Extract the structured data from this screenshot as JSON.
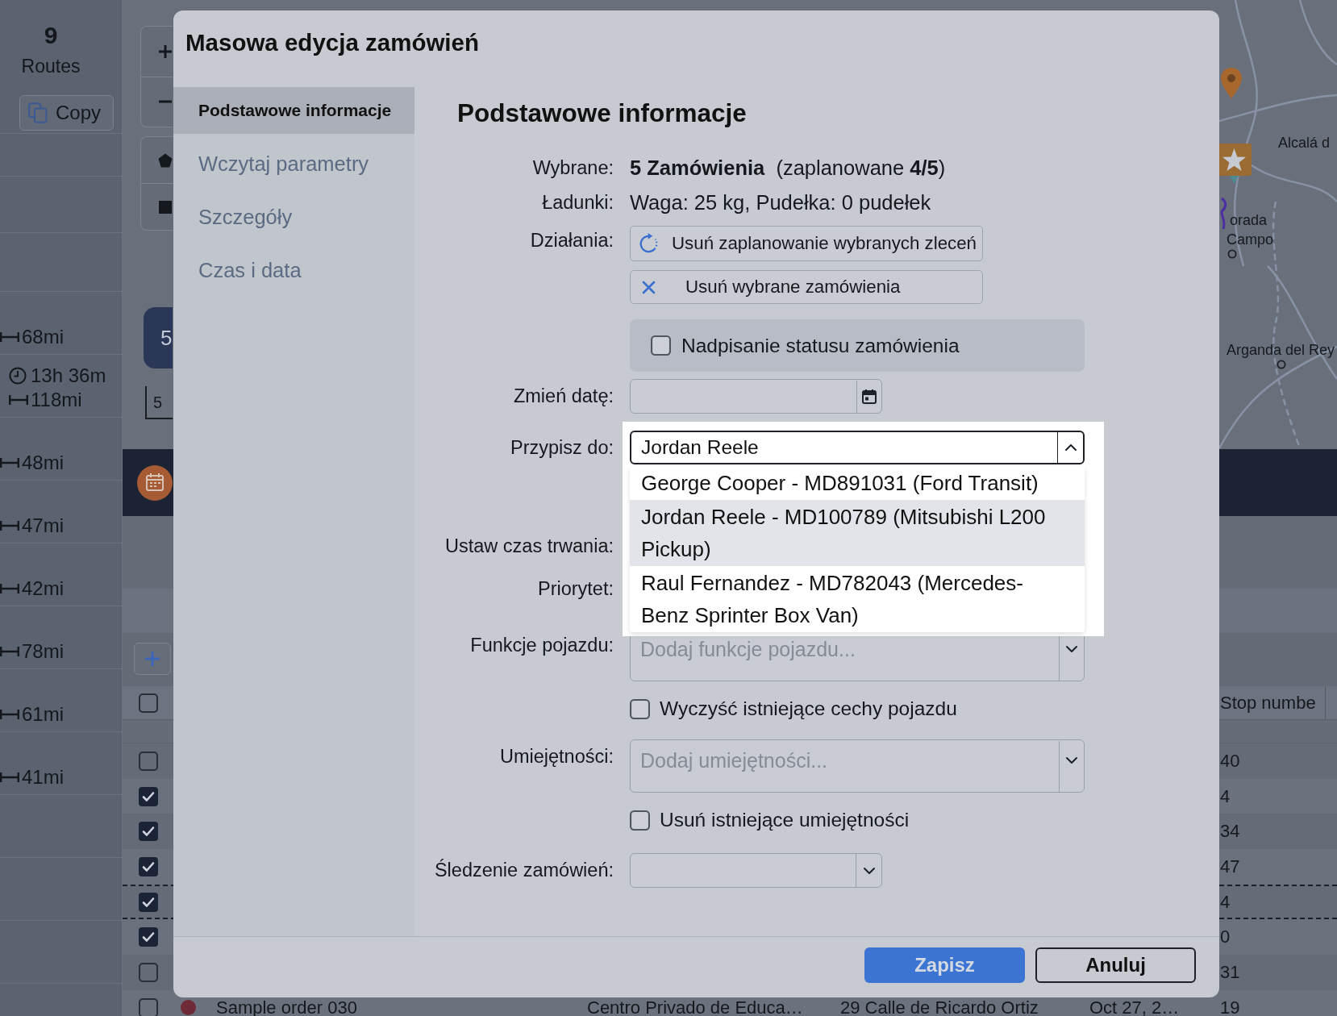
{
  "background": {
    "routes_panel": {
      "count": "9",
      "title": "Routes",
      "copy_button": "Copy",
      "routes": [
        {
          "distance": "68mi"
        },
        {
          "duration": "13h 36m",
          "distance": "118mi"
        },
        {
          "distance": "48mi"
        },
        {
          "distance": "47mi"
        },
        {
          "distance": "42mi"
        },
        {
          "distance": "78mi"
        },
        {
          "distance": "61mi"
        },
        {
          "distance": "41mi"
        }
      ]
    },
    "map": {
      "cluster_count": "5",
      "scale_label": "5",
      "places": [
        "Alcalá d",
        "orada",
        "Campo",
        "Arganda del Rey"
      ]
    },
    "orders_table": {
      "header": {
        "checked": false,
        "stop_column": "Stop numbe"
      },
      "rows": [
        {
          "checked": false,
          "outlined": false,
          "stop": "40"
        },
        {
          "checked": true,
          "outlined": false,
          "stop": "4"
        },
        {
          "checked": true,
          "outlined": false,
          "stop": "34"
        },
        {
          "checked": true,
          "outlined": false,
          "stop": "47"
        },
        {
          "checked": true,
          "outlined": true,
          "stop": "4"
        },
        {
          "checked": true,
          "outlined": false,
          "stop": "0"
        },
        {
          "checked": false,
          "outlined": false,
          "stop": "31"
        },
        {
          "checked": false,
          "outlined": false,
          "color": "#6e2a36",
          "name": "Sample order 030",
          "location": "Centro Privado de Educa…",
          "address": "29 Calle de Ricardo Ortiz",
          "date": "Oct 27, 2…",
          "stop": "19"
        }
      ]
    }
  },
  "dialog": {
    "title": "Masowa edycja zamówień",
    "sidebar": [
      {
        "label": "Podstawowe informacje",
        "selected": true
      },
      {
        "label": "Wczytaj parametry",
        "selected": false
      },
      {
        "label": "Szczegóły",
        "selected": false
      },
      {
        "label": "Czas i data",
        "selected": false
      }
    ],
    "section_title": "Podstawowe informacje",
    "fields": [
      {
        "kind": "text",
        "label": "Wybrane:",
        "value": "**5 Zamówienia**  (zaplanowane **4/5**)"
      },
      {
        "kind": "text",
        "label": "Ładunki:",
        "value": "Waga: 25 kg, Pudełka: 0 pudełek"
      },
      {
        "kind": "actions",
        "label": "Działania:",
        "buttons": [
          {
            "kind": "unschedule",
            "label": "Usuń zaplanowanie wybranych zleceń"
          },
          {
            "kind": "remove",
            "label": "Usuń wybrane zamówienia"
          }
        ]
      },
      {
        "kind": "checkbox_panel",
        "label": "Nadpisanie statusu zamówienia",
        "checked": false
      },
      {
        "kind": "date",
        "label": "Zmień datę:"
      },
      {
        "kind": "combo",
        "label": "Przypisz do:",
        "value": "Jordan Reele",
        "expanded": true,
        "options": [
          {
            "label": "George Cooper - MD891031 (Ford Transit)",
            "selected": false
          },
          {
            "label": "Jordan Reele - MD100789 (Mitsubishi L200 Pickup)",
            "selected": true
          },
          {
            "label": "Raul Fernandez - MD782043 (Mercedes-Benz Sprinter Box Van)",
            "selected": false
          }
        ]
      },
      {
        "kind": "label",
        "label": "Ustaw czas trwania:"
      },
      {
        "kind": "label",
        "label": "Priorytet:"
      },
      {
        "kind": "multiselect",
        "label": "Funkcje pojazdu:",
        "placeholder": "Dodaj funkcje pojazdu..."
      },
      {
        "kind": "checkbox",
        "label": "Wyczyść istniejące cechy pojazdu",
        "checked": false
      },
      {
        "kind": "multiselect",
        "label": "Umiejętności:",
        "placeholder": "Dodaj umiejętności..."
      },
      {
        "kind": "checkbox",
        "label": "Usuń istniejące umiejętności",
        "checked": false
      },
      {
        "kind": "select",
        "label": "Śledzenie zamówień:",
        "expanded": false
      }
    ],
    "buttons": [
      {
        "kind": "primary",
        "label": "Zapisz"
      },
      {
        "kind": "secondary",
        "label": "Anuluj"
      }
    ]
  }
}
